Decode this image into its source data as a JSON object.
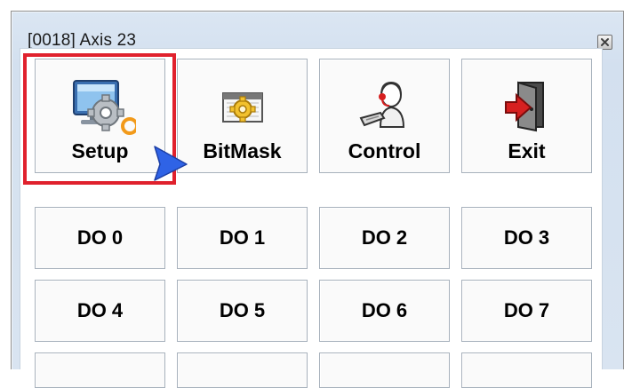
{
  "window": {
    "title": "[0018] Axis 23",
    "close_icon": "close-icon"
  },
  "toolbar": {
    "buttons": [
      {
        "label": "Setup",
        "icon": "setup-icon"
      },
      {
        "label": "BitMask",
        "icon": "bitmask-icon"
      },
      {
        "label": "Control",
        "icon": "control-icon"
      },
      {
        "label": "Exit",
        "icon": "exit-icon"
      }
    ]
  },
  "outputs": {
    "buttons": [
      {
        "label": "DO 0"
      },
      {
        "label": "DO 1"
      },
      {
        "label": "DO 2"
      },
      {
        "label": "DO 3"
      },
      {
        "label": "DO 4"
      },
      {
        "label": "DO 5"
      },
      {
        "label": "DO 6"
      },
      {
        "label": "DO 7"
      }
    ]
  },
  "colors": {
    "highlight": "#e0212d",
    "cursor": "#2f63e6"
  }
}
